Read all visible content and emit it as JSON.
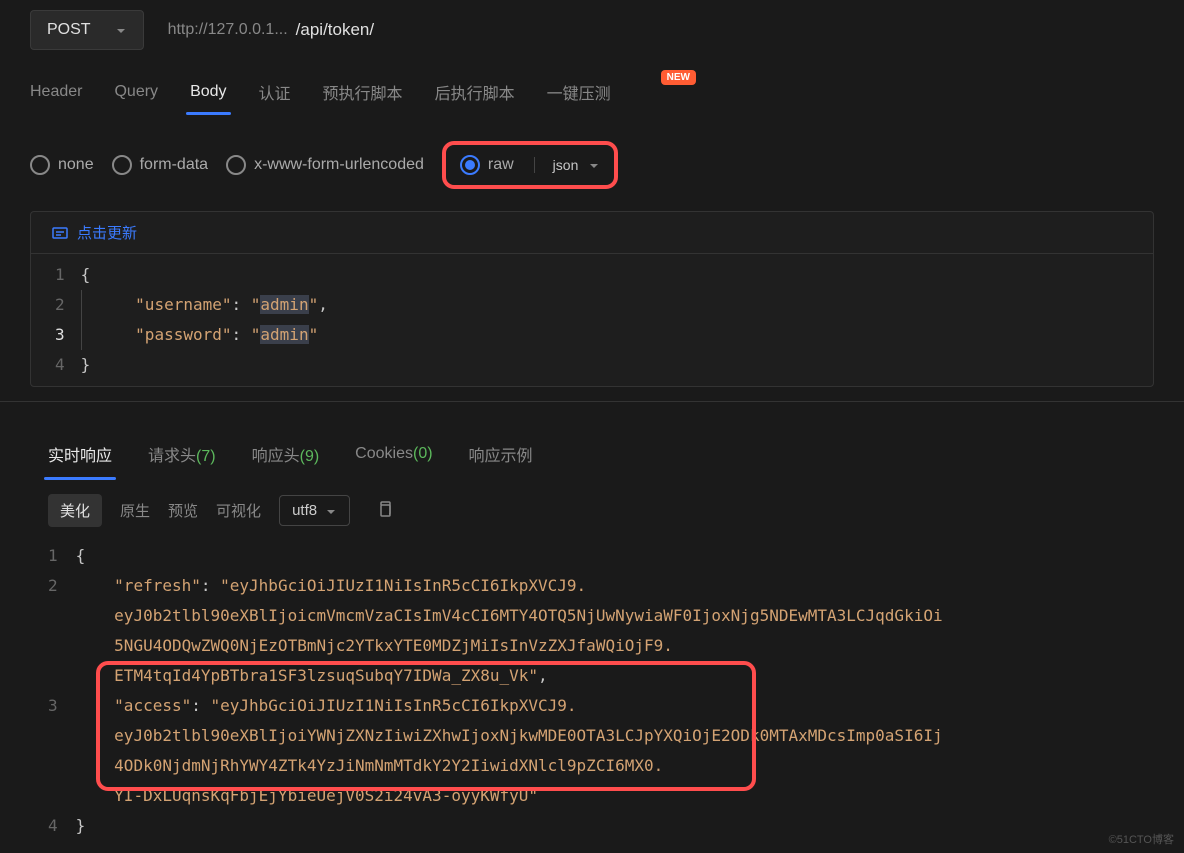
{
  "request": {
    "method": "POST",
    "url_host": "http://127.0.0.1...",
    "url_path": "/api/token/"
  },
  "req_tabs": {
    "header": "Header",
    "query": "Query",
    "body": "Body",
    "auth": "认证",
    "pre_script": "预执行脚本",
    "post_script": "后执行脚本",
    "load_test": "一键压测",
    "badge": "NEW"
  },
  "body_types": {
    "none": "none",
    "form_data": "form-data",
    "urlencoded": "x-www-form-urlencoded",
    "raw": "raw",
    "format_selected": "json"
  },
  "editor": {
    "refresh_label": "点击更新",
    "lines": [
      "1",
      "2",
      "3",
      "4"
    ],
    "body_json": {
      "username_key": "\"username\"",
      "username_val": "\"admin\"",
      "password_key": "\"password\"",
      "password_val": "\"admin\""
    }
  },
  "resp_tabs": {
    "realtime": "实时响应",
    "req_headers": "请求头",
    "req_headers_count": "(7)",
    "resp_headers": "响应头",
    "resp_headers_count": "(9)",
    "cookies": "Cookies",
    "cookies_count": "(0)",
    "example": "响应示例"
  },
  "resp_toolbar": {
    "beautify": "美化",
    "raw": "原生",
    "preview": "预览",
    "visualize": "可视化",
    "encoding": "utf8"
  },
  "response": {
    "lines": [
      "1",
      "2",
      "",
      "",
      "",
      "3",
      "",
      "",
      "",
      "4"
    ],
    "refresh_key": "\"refresh\"",
    "refresh_val_l1": "\"eyJhbGciOiJIUzI1NiIsInR5cCI6IkpXVCJ9.",
    "refresh_val_l2": "eyJ0b2tlbl90eXBlIjoicmVmcmVzaCIsImV4cCI6MTY4OTQ5NjUwNywiaWF0IjoxNjg5NDEwMTA3LCJqdGkiOi",
    "refresh_val_l3": "5NGU4ODQwZWQ0NjEzOTBmNjc2YTkxYTE0MDZjMiIsInVzZXJfaWQiOjF9.",
    "refresh_val_l4": "ETM4tqId4YpBTbra1SF3lzsuqSubqY7IDWa_ZX8u_Vk\"",
    "access_key": "\"access\"",
    "access_val_l1": "\"eyJhbGciOiJIUzI1NiIsInR5cCI6IkpXVCJ9.",
    "access_val_l2": "eyJ0b2tlbl90eXBlIjoiYWNjZXNzIiwiZXhwIjoxNjkwMDE0OTA3LCJpYXQiOjE2ODk0MTAxMDcsImp0aSI6Ij",
    "access_val_l3": "4ODk0NjdmNjRhYWY4ZTk4YzJiNmNmMTdkY2Y2IiwidXNlcl9pZCI6MX0.",
    "access_val_l4": "YI-DxLUqnsKqFbjEjYbieUejV0S2i24vA3-oyyKWfyU\""
  },
  "watermark": "©51CTO博客"
}
